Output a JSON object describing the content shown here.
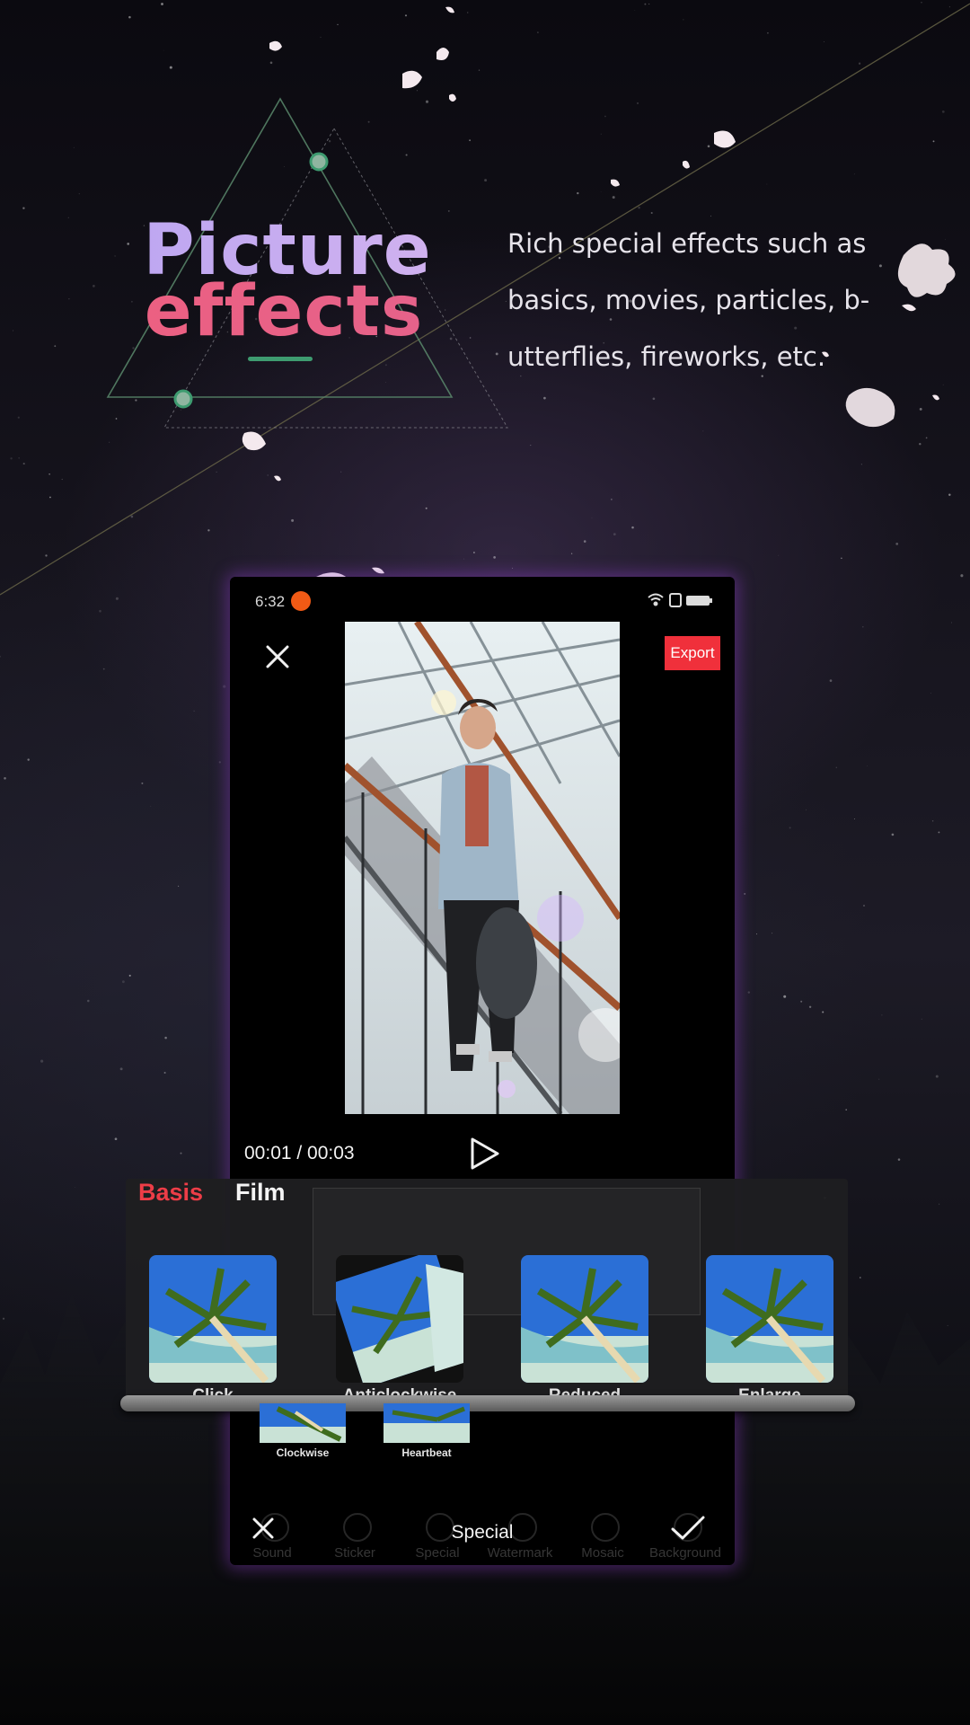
{
  "hero": {
    "title_line1": "Picture",
    "title_line2": "effects",
    "description_lines": [
      "Rich special effects such as",
      "basics, movies, particles, b-",
      "utterflies, fireworks, etc."
    ]
  },
  "status_bar": {
    "time": "6:32",
    "icons": [
      "notification-app-icon",
      "wifi-icon",
      "sim-icon",
      "battery-icon"
    ]
  },
  "editor": {
    "export_label": "Export",
    "time_display": "00:01 / 00:03"
  },
  "effects": {
    "tabs": [
      "Basis",
      "Film"
    ],
    "active_tab": "Basis",
    "items": [
      {
        "label": "Click"
      },
      {
        "label": "Anticlockwise"
      },
      {
        "label": "Reduced"
      },
      {
        "label": "Enlarge"
      }
    ],
    "secondary_items": [
      {
        "label": "Clockwise"
      },
      {
        "label": "Heartbeat"
      }
    ]
  },
  "toolbar": {
    "title": "Special",
    "ghost_tabs": [
      "Sound",
      "Sticker",
      "Special",
      "Watermark",
      "Mosaic",
      "Background"
    ]
  },
  "colors": {
    "accent_red": "#f0303b",
    "tab_active": "#ed3d47",
    "title_purple": "#b6a2f2",
    "title_pink": "#ef5f7e",
    "line_green": "#3e9b70"
  }
}
